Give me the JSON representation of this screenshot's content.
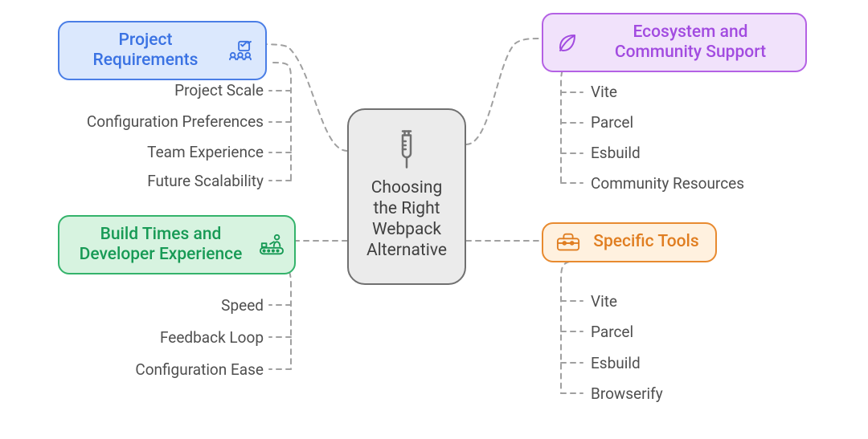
{
  "center": {
    "title_line1": "Choosing",
    "title_line2": "the Right",
    "title_line3": "Webpack",
    "title_line4": "Alternative"
  },
  "branches": {
    "top_left": {
      "label": "Project Requirements",
      "icon": "checklist-icon",
      "color_theme": "blue",
      "leaves": [
        "Project Scale",
        "Configuration Preferences",
        "Team Experience",
        "Future Scalability"
      ]
    },
    "bottom_left": {
      "label": "Build Times and Developer Experience",
      "icon": "conveyor-icon",
      "color_theme": "green",
      "leaves": [
        "Speed",
        "Feedback Loop",
        "Configuration Ease"
      ]
    },
    "top_right": {
      "label": "Ecosystem and Community Support",
      "icon": "leaf-icon",
      "color_theme": "purple",
      "leaves": [
        "Vite",
        "Parcel",
        "Esbuild",
        "Community Resources"
      ]
    },
    "bottom_right": {
      "label": "Specific Tools",
      "icon": "toolbox-icon",
      "color_theme": "orange",
      "leaves": [
        "Vite",
        "Parcel",
        "Esbuild",
        "Browserify"
      ]
    }
  },
  "chart_data": {
    "type": "mindmap",
    "root": "Choosing the Right Webpack Alternative",
    "branches": [
      {
        "name": "Project Requirements",
        "children": [
          "Project Scale",
          "Configuration Preferences",
          "Team Experience",
          "Future Scalability"
        ]
      },
      {
        "name": "Build Times and Developer Experience",
        "children": [
          "Speed",
          "Feedback Loop",
          "Configuration Ease"
        ]
      },
      {
        "name": "Ecosystem and Community Support",
        "children": [
          "Vite",
          "Parcel",
          "Esbuild",
          "Community Resources"
        ]
      },
      {
        "name": "Specific Tools",
        "children": [
          "Vite",
          "Parcel",
          "Esbuild",
          "Browserify"
        ]
      }
    ]
  }
}
